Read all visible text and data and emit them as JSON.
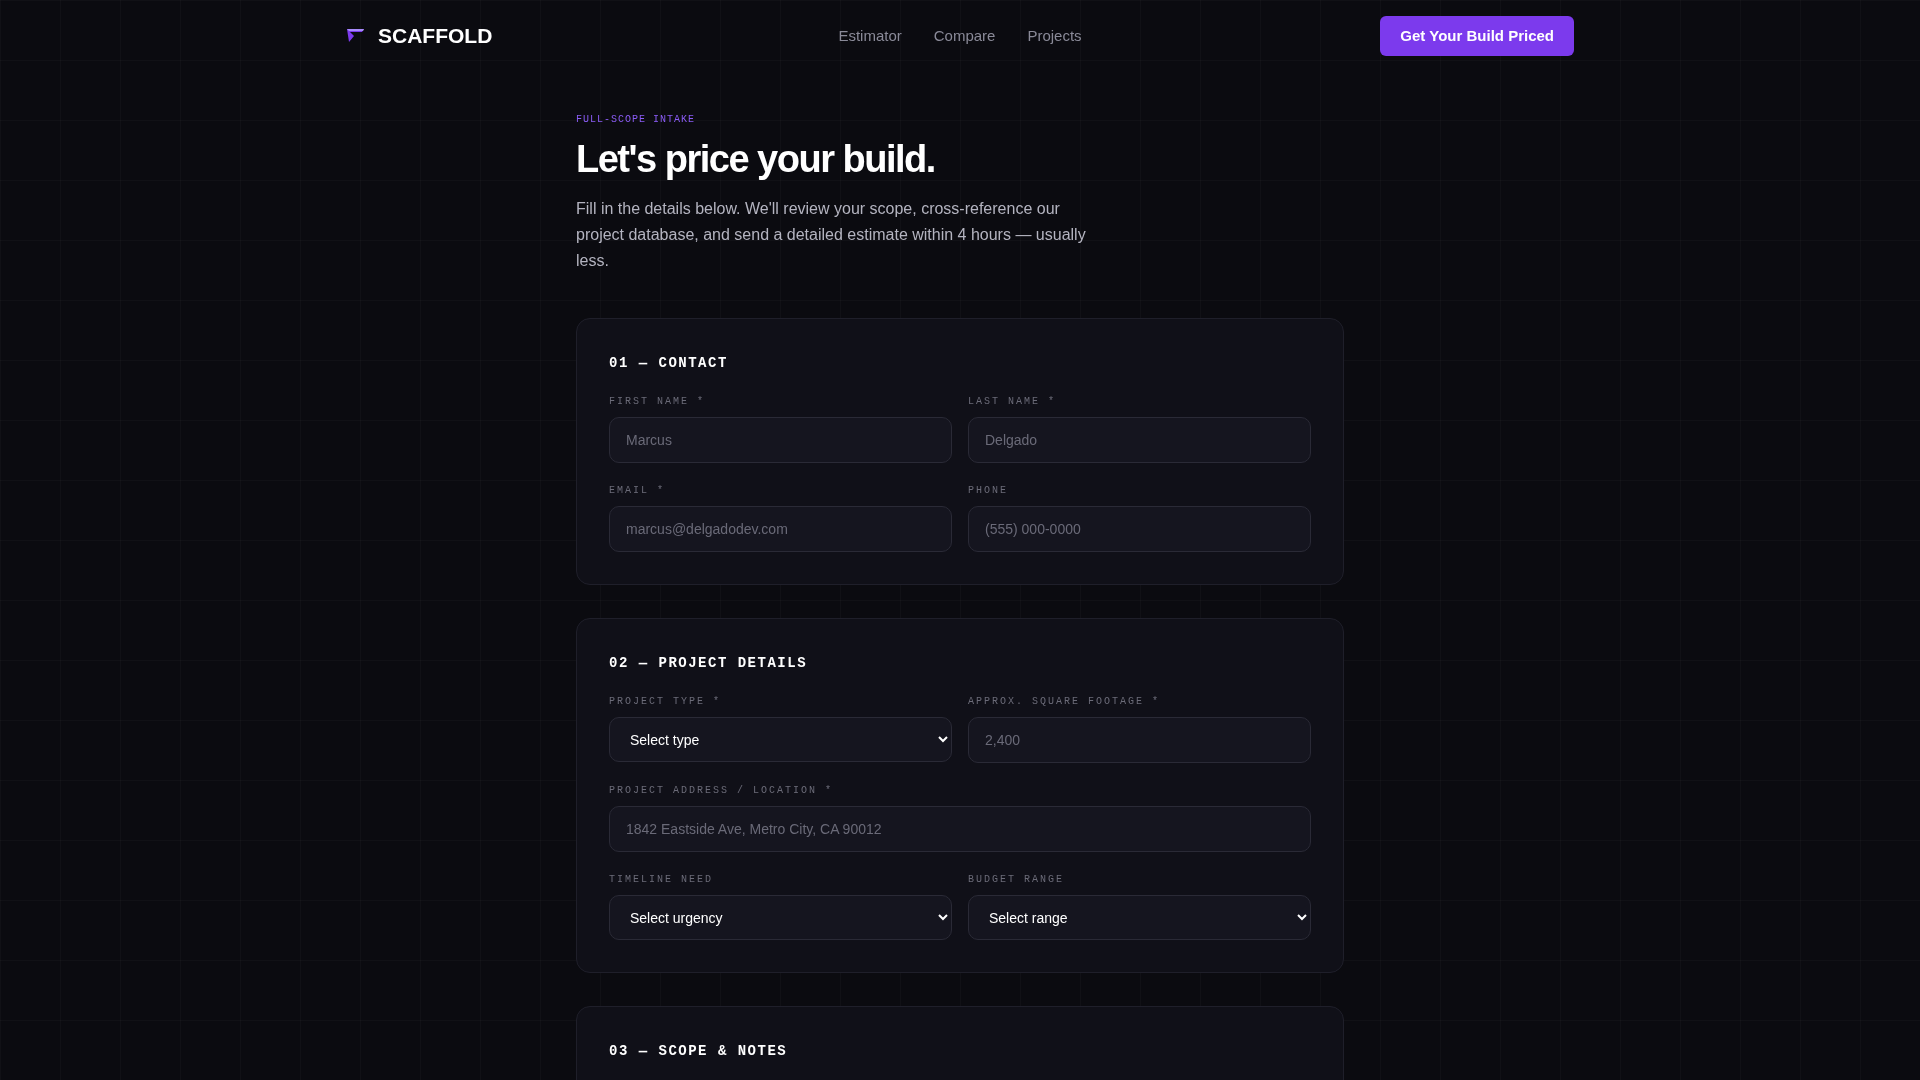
{
  "header": {
    "brand": "SCAFFOLD",
    "nav": [
      "Estimator",
      "Compare",
      "Projects"
    ],
    "cta": "Get Your Build Priced"
  },
  "hero": {
    "eyebrow": "FULL-SCOPE INTAKE",
    "title": "Let's price your build.",
    "intro": "Fill in the details below. We'll review your scope, cross-reference our project database, and send a detailed estimate within 4 hours — usually less."
  },
  "sections": [
    {
      "title": "01 — CONTACT",
      "fields": [
        {
          "kind": "input",
          "label": "FIRST NAME *",
          "placeholder": "Marcus"
        },
        {
          "kind": "input",
          "label": "LAST NAME *",
          "placeholder": "Delgado"
        },
        {
          "kind": "input",
          "label": "EMAIL *",
          "placeholder": "marcus@delgadodev.com"
        },
        {
          "kind": "input",
          "label": "PHONE",
          "placeholder": "(555) 000-0000"
        }
      ]
    },
    {
      "title": "02 — PROJECT DETAILS",
      "fields": [
        {
          "kind": "select",
          "label": "PROJECT TYPE *",
          "value": "Select type"
        },
        {
          "kind": "input",
          "label": "APPROX. SQUARE FOOTAGE *",
          "placeholder": "2,400"
        },
        {
          "kind": "input",
          "label": "PROJECT ADDRESS / LOCATION *",
          "placeholder": "1842 Eastside Ave, Metro City, CA 90012",
          "wide": true
        },
        {
          "kind": "select",
          "label": "TIMELINE NEED",
          "value": "Select urgency"
        },
        {
          "kind": "select",
          "label": "BUDGET RANGE",
          "value": "Select range"
        }
      ]
    },
    {
      "title": "03 — SCOPE & NOTES"
    }
  ]
}
